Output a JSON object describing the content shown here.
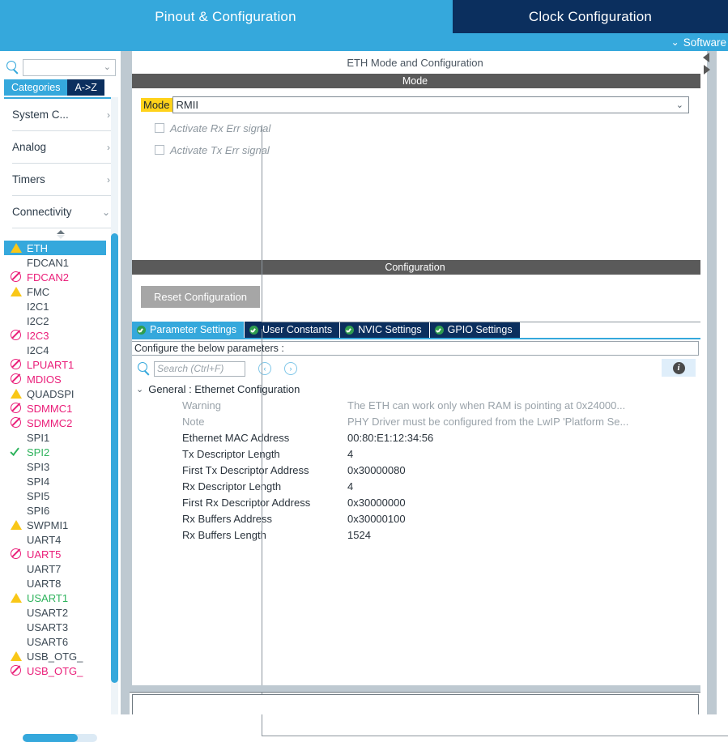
{
  "topbar": {
    "tabs": [
      {
        "label": "Pinout & Configuration",
        "active": true
      },
      {
        "label": "Clock Configuration",
        "active": false
      }
    ],
    "software_menu": "Software",
    "chevron": "⌄"
  },
  "sidebar": {
    "search": {
      "value": "",
      "placeholder": ""
    },
    "view_tabs": [
      {
        "label": "Categories",
        "active": true
      },
      {
        "label": "A->Z",
        "active": false
      }
    ],
    "groups": [
      {
        "label": "System C...",
        "arrow": "›",
        "expanded": false
      },
      {
        "label": "Analog",
        "arrow": "›",
        "expanded": false
      },
      {
        "label": "Timers",
        "arrow": "›",
        "expanded": false
      },
      {
        "label": "Connectivity",
        "arrow": "⌄",
        "expanded": true
      }
    ],
    "peripherals": [
      {
        "label": "ETH",
        "icon": "warning-icon",
        "state": "selected"
      },
      {
        "label": "FDCAN1",
        "icon": "none",
        "state": "normal"
      },
      {
        "label": "FDCAN2",
        "icon": "forbidden-icon",
        "state": "unavailable"
      },
      {
        "label": "FMC",
        "icon": "warning-icon",
        "state": "normal"
      },
      {
        "label": "I2C1",
        "icon": "none",
        "state": "normal"
      },
      {
        "label": "I2C2",
        "icon": "none",
        "state": "normal"
      },
      {
        "label": "I2C3",
        "icon": "forbidden-icon",
        "state": "unavailable"
      },
      {
        "label": "I2C4",
        "icon": "none",
        "state": "normal"
      },
      {
        "label": "LPUART1",
        "icon": "forbidden-icon",
        "state": "unavailable"
      },
      {
        "label": "MDIOS",
        "icon": "forbidden-icon",
        "state": "unavailable"
      },
      {
        "label": "QUADSPI",
        "icon": "warning-icon",
        "state": "normal"
      },
      {
        "label": "SDMMC1",
        "icon": "forbidden-icon",
        "state": "unavailable"
      },
      {
        "label": "SDMMC2",
        "icon": "forbidden-icon",
        "state": "unavailable"
      },
      {
        "label": "SPI1",
        "icon": "none",
        "state": "normal"
      },
      {
        "label": "SPI2",
        "icon": "check-icon",
        "state": "configured"
      },
      {
        "label": "SPI3",
        "icon": "none",
        "state": "normal"
      },
      {
        "label": "SPI4",
        "icon": "none",
        "state": "normal"
      },
      {
        "label": "SPI5",
        "icon": "none",
        "state": "normal"
      },
      {
        "label": "SPI6",
        "icon": "none",
        "state": "normal"
      },
      {
        "label": "SWPMI1",
        "icon": "warning-icon",
        "state": "normal"
      },
      {
        "label": "UART4",
        "icon": "none",
        "state": "normal"
      },
      {
        "label": "UART5",
        "icon": "forbidden-icon",
        "state": "unavailable"
      },
      {
        "label": "UART7",
        "icon": "none",
        "state": "normal"
      },
      {
        "label": "UART8",
        "icon": "none",
        "state": "normal"
      },
      {
        "label": "USART1",
        "icon": "warning-icon",
        "state": "configured"
      },
      {
        "label": "USART2",
        "icon": "none",
        "state": "normal"
      },
      {
        "label": "USART3",
        "icon": "none",
        "state": "normal"
      },
      {
        "label": "USART6",
        "icon": "none",
        "state": "normal"
      },
      {
        "label": "USB_OTG_",
        "icon": "warning-icon",
        "state": "normal"
      },
      {
        "label": "USB_OTG_",
        "icon": "forbidden-icon",
        "state": "unavailable"
      }
    ]
  },
  "main": {
    "panel_title": "ETH Mode and Configuration",
    "mode_section": {
      "header": "Mode",
      "mode_label": "Mode",
      "mode_value": "RMII",
      "mode_chevron": "⌄",
      "checkboxes": [
        {
          "label": "Activate Rx Err signal",
          "checked": false
        },
        {
          "label": "Activate Tx Err signal",
          "checked": false
        }
      ]
    },
    "config_section": {
      "header": "Configuration",
      "reset_button": "Reset Configuration",
      "tabs": [
        {
          "label": "Parameter Settings",
          "active": true
        },
        {
          "label": "User Constants",
          "active": false
        },
        {
          "label": "NVIC Settings",
          "active": false
        },
        {
          "label": "GPIO Settings",
          "active": false
        }
      ],
      "configure_hint": "Configure the below parameters :",
      "search": {
        "value": "",
        "placeholder": "Search (Ctrl+F)"
      },
      "nav_prev": "‹",
      "nav_next": "›",
      "info_glyph": "i",
      "tree": {
        "chevron": "⌄",
        "group_label": "General : Ethernet Configuration",
        "rows": [
          {
            "name": "Warning",
            "value": "The ETH can work only when RAM is pointing at 0x24000...",
            "muted": true
          },
          {
            "name": "Note",
            "value": "PHY Driver must be configured from the LwIP 'Platform Se...",
            "muted": true
          },
          {
            "name": "Ethernet MAC Address",
            "value": "00:80:E1:12:34:56",
            "muted": false
          },
          {
            "name": "Tx Descriptor Length",
            "value": "4",
            "muted": false
          },
          {
            "name": "First Tx Descriptor Address",
            "value": "0x30000080",
            "muted": false
          },
          {
            "name": "Rx Descriptor Length",
            "value": "4",
            "muted": false
          },
          {
            "name": "First Rx Descriptor Address",
            "value": "0x30000000",
            "muted": false
          },
          {
            "name": "Rx Buffers Address",
            "value": "0x30000100",
            "muted": false
          },
          {
            "name": "Rx Buffers Length",
            "value": "1524",
            "muted": false
          }
        ]
      }
    }
  },
  "colors": {
    "accent_blue": "#35a8dc",
    "dark_navy": "#0b2f5e",
    "warning_yellow": "#f9c717",
    "error_pink": "#ea1e79",
    "ok_green": "#2eb35c",
    "highlight_yellow": "#ffd21a",
    "section_gray": "#5a5a5a"
  }
}
